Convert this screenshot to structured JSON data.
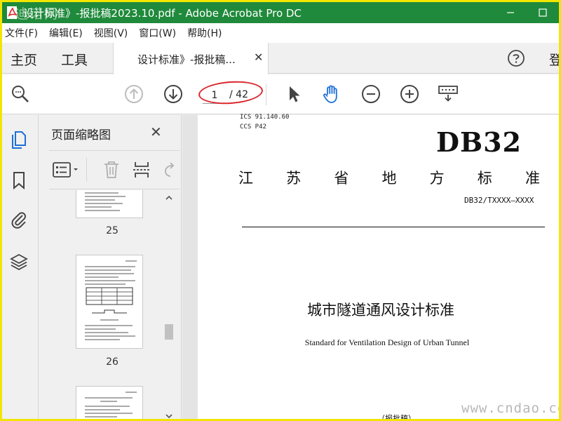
{
  "titlebar": {
    "title": "设计标准》-报批稿2023.10.pdf - Adobe Acrobat Pro DC",
    "watermark": "迪诺网"
  },
  "menubar": {
    "items": [
      "文件(F)",
      "编辑(E)",
      "视图(V)",
      "窗口(W)",
      "帮助(H)"
    ]
  },
  "tabs": {
    "home": "主页",
    "tools": "工具",
    "document": "设计标准》-报批稿...",
    "login": "登"
  },
  "toolbar": {
    "current_page": "1",
    "total_pages": "/ 42"
  },
  "panel": {
    "title": "页面缩略图",
    "thumbnails": [
      {
        "page": "25"
      },
      {
        "page": "26"
      }
    ]
  },
  "document": {
    "ics_line": "ICS  91.140.60",
    "ccs_line": "CCS  P42",
    "code": "DB32",
    "province_chars": [
      "江",
      "苏",
      "省",
      "地",
      "方",
      "标",
      "准"
    ],
    "standard_number": "DB32/TXXXX—XXXX",
    "title": "城市隧道通风设计标准",
    "subtitle": "Standard for Ventilation Design of Urban Tunnel",
    "note": "（报批稿）"
  },
  "watermark": "www.cndao.com",
  "colors": {
    "titlebar": "#1f8a3b",
    "accent_blue": "#1e6fd9",
    "highlight_red": "#d9282d",
    "frame_yellow": "#f2e600"
  }
}
